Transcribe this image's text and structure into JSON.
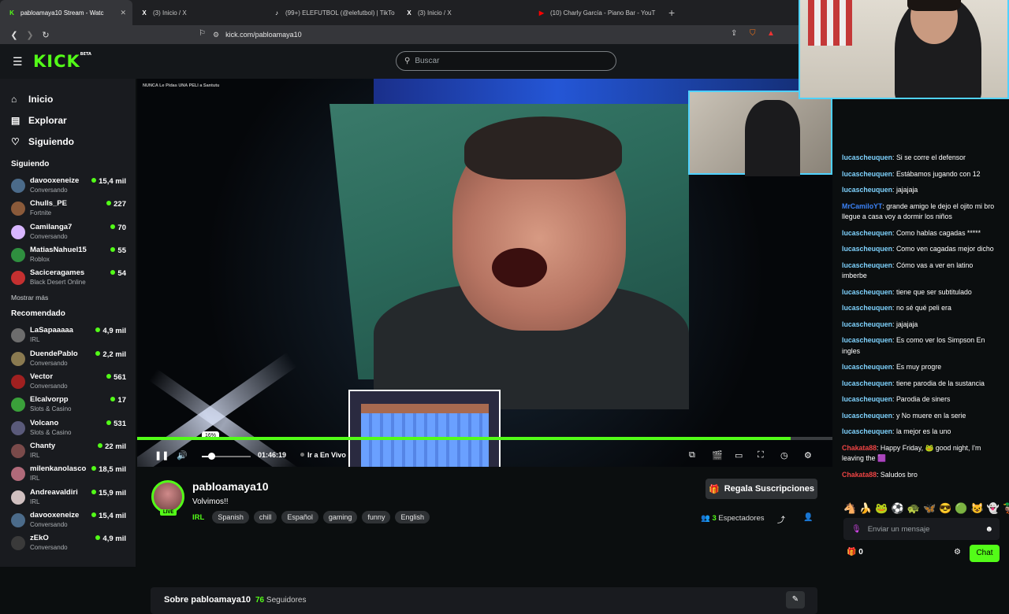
{
  "browser": {
    "tabs": [
      {
        "title": "pabloamaya10 Stream - Watc",
        "favicon": "K",
        "active": true,
        "color": "#53fc18"
      },
      {
        "title": "(3) Inicio / X",
        "favicon": "X",
        "active": false,
        "color": "#ffffff"
      },
      {
        "title": "(99+) ELEFUTBOL (@elefutbol) | TikTo",
        "favicon": "♪",
        "active": false,
        "color": "#ffffff"
      },
      {
        "title": "(3) Inicio / X",
        "favicon": "X",
        "active": false,
        "color": "#ffffff"
      },
      {
        "title": "(10) Charly García - Piano Bar - YouT",
        "favicon": "▶",
        "active": false,
        "color": "#ff0000"
      }
    ],
    "url": "kick.com/pabloamaya10"
  },
  "header": {
    "logo": "KICK",
    "logo_badge": "BETA",
    "search_placeholder": "Buscar"
  },
  "sidebar": {
    "nav": [
      {
        "label": "Inicio",
        "icon": "home-icon"
      },
      {
        "label": "Explorar",
        "icon": "explore-icon"
      },
      {
        "label": "Siguiendo",
        "icon": "heart-icon"
      }
    ],
    "following_title": "Siguiendo",
    "following": [
      {
        "name": "davooxeneize",
        "category": "Conversando",
        "viewers": "15,4 mil",
        "color": "#4b6b8a"
      },
      {
        "name": "Chulls_PE",
        "category": "Fortnite",
        "viewers": "227",
        "color": "#8a5a3a"
      },
      {
        "name": "Camilanga7",
        "category": "Conversando",
        "viewers": "70",
        "color": "#d8b6ff"
      },
      {
        "name": "MatiasNahuel15",
        "category": "Roblox",
        "viewers": "55",
        "color": "#2f8f3f"
      },
      {
        "name": "Saciceragames",
        "category": "Black Desert Online",
        "viewers": "54",
        "color": "#c43030"
      }
    ],
    "show_more": "Mostrar más",
    "recommended_title": "Recomendado",
    "recommended": [
      {
        "name": "LaSapaaaaa",
        "category": "IRL",
        "viewers": "4,9 mil",
        "color": "#6d6d6d"
      },
      {
        "name": "DuendePablo",
        "category": "Conversando",
        "viewers": "2,2 mil",
        "color": "#8a7a50"
      },
      {
        "name": "Vector",
        "category": "Conversando",
        "viewers": "561",
        "color": "#a02020"
      },
      {
        "name": "Elcalvorpp",
        "category": "Slots & Casino",
        "viewers": "17",
        "color": "#3aa03a"
      },
      {
        "name": "Volcano",
        "category": "Slots & Casino",
        "viewers": "531",
        "color": "#5a5a7a"
      },
      {
        "name": "Chanty",
        "category": "IRL",
        "viewers": "22 mil",
        "color": "#7a4a4a"
      },
      {
        "name": "milenkanolasco",
        "category": "IRL",
        "viewers": "18,5 mil",
        "color": "#b06a7a"
      },
      {
        "name": "Andreavaldiri",
        "category": "IRL",
        "viewers": "15,9 mil",
        "color": "#d0c0c0"
      },
      {
        "name": "davooxeneize",
        "category": "Conversando",
        "viewers": "15,4 mil",
        "color": "#4b6b8a"
      },
      {
        "name": "zEkO",
        "category": "Conversando",
        "viewers": "4,9 mil",
        "color": "#3a3a3a"
      }
    ]
  },
  "player": {
    "overlay_title": "NUNCA Le Pidas UNA PELI a Santutu",
    "volume_percent_label": "16%",
    "volume": 0.16,
    "progress": 0.94,
    "time": "01:46:19",
    "go_live": "Ir a En Vivo"
  },
  "channel": {
    "name": "pabloamaya10",
    "live_badge": "LIVE",
    "title": "Volvimos!!",
    "category": "IRL",
    "tags": [
      "Spanish",
      "chill",
      "Español",
      "gaming",
      "funny",
      "English"
    ],
    "gift_button": "Regala Suscripciones",
    "viewers_count": "3",
    "viewers_label": "Espectadores",
    "about_title": "Sobre pabloamaya10",
    "followers_count": "76",
    "followers_label": "Seguidores"
  },
  "chat": {
    "messages": [
      {
        "user": "lucascheuquen",
        "text": "Si se corre el defensor",
        "color": "#7fd3ff"
      },
      {
        "user": "lucascheuquen",
        "text": "Estábamos jugando con 12",
        "color": "#7fd3ff"
      },
      {
        "user": "lucascheuquen",
        "text": "jajajaja",
        "color": "#7fd3ff"
      },
      {
        "user": "MrCamiloYT",
        "text": "grande amigo le dejo el ojito mi bro llegue a casa voy a dormir los niños",
        "color": "#3b82f6"
      },
      {
        "user": "lucascheuquen",
        "text": "Como hablas cagadas *****",
        "color": "#7fd3ff"
      },
      {
        "user": "lucascheuquen",
        "text": "Como ven cagadas mejor dicho",
        "color": "#7fd3ff"
      },
      {
        "user": "lucascheuquen",
        "text": "Cómo vas a ver en latino imberbe",
        "color": "#7fd3ff"
      },
      {
        "user": "lucascheuquen",
        "text": "tiene que ser subtitulado",
        "color": "#7fd3ff"
      },
      {
        "user": "lucascheuquen",
        "text": "no sé qué peli era",
        "color": "#7fd3ff"
      },
      {
        "user": "lucascheuquen",
        "text": "jajajaja",
        "color": "#7fd3ff"
      },
      {
        "user": "lucascheuquen",
        "text": "Es como ver los Simpson En ingles",
        "color": "#7fd3ff"
      },
      {
        "user": "lucascheuquen",
        "text": "Es muy progre",
        "color": "#7fd3ff"
      },
      {
        "user": "lucascheuquen",
        "text": "tiene parodia de la sustancia",
        "color": "#7fd3ff"
      },
      {
        "user": "lucascheuquen",
        "text": "Parodia de siners",
        "color": "#7fd3ff"
      },
      {
        "user": "lucascheuquen",
        "text": "y No muere en la serie",
        "color": "#7fd3ff"
      },
      {
        "user": "lucascheuquen",
        "text": "la mejor es la uno",
        "color": "#7fd3ff"
      },
      {
        "user": "Chakata88",
        "text": "Happy Friday, 🐸 good night, I'm leaving the 🟪",
        "color": "#ef4444"
      },
      {
        "user": "Chakata88",
        "text": "Saludos bro",
        "color": "#ef4444"
      }
    ],
    "emotes": [
      "🐴",
      "🍌",
      "🐸",
      "⚽",
      "🐢",
      "🦋",
      "😎",
      "🟢",
      "😺",
      "👻",
      "🦆",
      "🎉"
    ],
    "input_placeholder": "Enviar un mensaje",
    "points": "0",
    "send_button": "Chat"
  }
}
